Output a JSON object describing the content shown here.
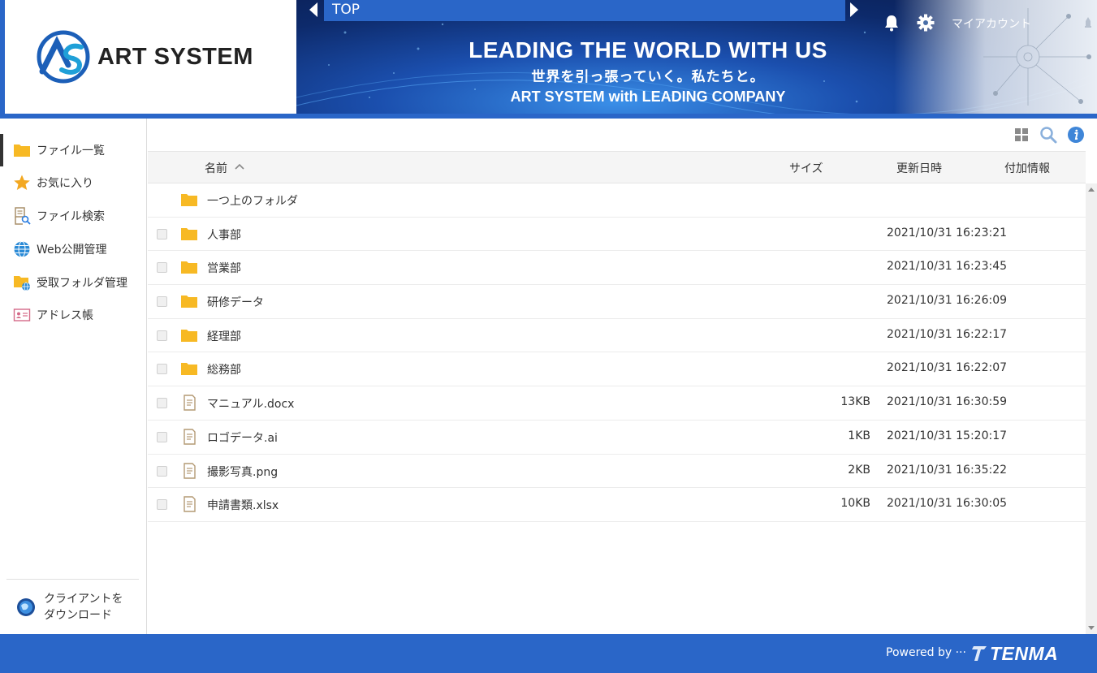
{
  "app": {
    "logo_text": "ART SYSTEM",
    "breadcrumb": "TOP",
    "account_label": "マイアカウント",
    "banner": {
      "headline": "LEADING THE WORLD WITH US",
      "subheadline": "世界を引っ張っていく。私たちと。",
      "tagline": "ART SYSTEM with LEADING COMPANY"
    }
  },
  "sidebar": {
    "items": [
      {
        "label": "ファイル一覧",
        "icon": "folder-icon",
        "active": true
      },
      {
        "label": "お気に入り",
        "icon": "star-icon",
        "active": false
      },
      {
        "label": "ファイル検索",
        "icon": "file-search-icon",
        "active": false
      },
      {
        "label": "Web公開管理",
        "icon": "globe-icon",
        "active": false
      },
      {
        "label": "受取フォルダ管理",
        "icon": "folder-globe-icon",
        "active": false
      },
      {
        "label": "アドレス帳",
        "icon": "address-book-icon",
        "active": false
      }
    ],
    "download": {
      "line1": "クライアントを",
      "line2": "ダウンロード"
    }
  },
  "table": {
    "columns": {
      "name": "名前",
      "size": "サイズ",
      "modified": "更新日時",
      "info": "付加情報"
    },
    "parent_folder": "一つ上のフォルダ",
    "rows": [
      {
        "name": "人事部",
        "type": "folder",
        "size": "",
        "modified": "2021/10/31 16:23:21"
      },
      {
        "name": "営業部",
        "type": "folder",
        "size": "",
        "modified": "2021/10/31 16:23:45"
      },
      {
        "name": "研修データ",
        "type": "folder",
        "size": "",
        "modified": "2021/10/31 16:26:09"
      },
      {
        "name": "経理部",
        "type": "folder",
        "size": "",
        "modified": "2021/10/31 16:22:17"
      },
      {
        "name": "総務部",
        "type": "folder",
        "size": "",
        "modified": "2021/10/31 16:22:07"
      },
      {
        "name": "マニュアル.docx",
        "type": "file",
        "size": "13KB",
        "modified": "2021/10/31 16:30:59"
      },
      {
        "name": "ロゴデータ.ai",
        "type": "file",
        "size": "1KB",
        "modified": "2021/10/31 15:20:17"
      },
      {
        "name": "撮影写真.png",
        "type": "file",
        "size": "2KB",
        "modified": "2021/10/31 16:35:22"
      },
      {
        "name": "申請書類.xlsx",
        "type": "file",
        "size": "10KB",
        "modified": "2021/10/31 16:30:05"
      }
    ]
  },
  "footer": {
    "powered_by": "Powered by ···",
    "brand": "TENMA"
  },
  "colors": {
    "primary": "#2a66c8",
    "folder": "#f7b924",
    "star": "#f3a821"
  }
}
